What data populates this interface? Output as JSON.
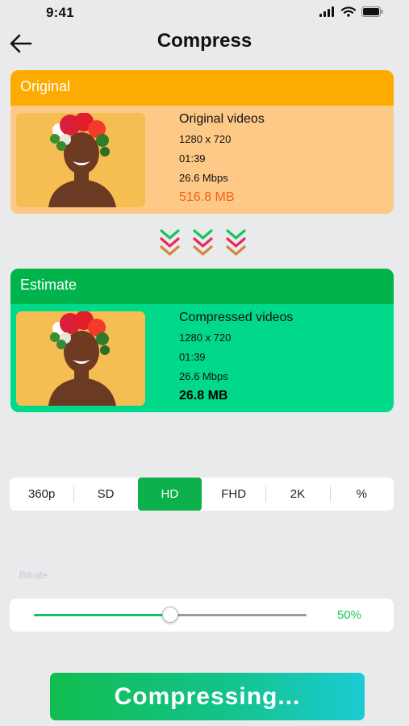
{
  "status_bar": {
    "time": "9:41"
  },
  "header": {
    "title": "Compress"
  },
  "original": {
    "section_label": "Original",
    "title": "Original videos",
    "resolution": "1280 x 720",
    "duration": "01:39",
    "bitrate": "26.6 Mbps",
    "size": "516.8 MB"
  },
  "estimate": {
    "section_label": "Estimate",
    "title": "Compressed videos",
    "resolution": "1280 x 720",
    "duration": "01:39",
    "bitrate": "26.6 Mbps",
    "size": "26.8 MB"
  },
  "resolutions": {
    "options": [
      "360p",
      "SD",
      "HD",
      "FHD",
      "2K",
      "%"
    ],
    "selected": "HD"
  },
  "bitrate": {
    "label": "Bitrate",
    "value_label": "50%",
    "value": 0.5
  },
  "action": {
    "label": "Compressing..."
  },
  "colors": {
    "original_header": "#fdab00",
    "original_body": "#fec986",
    "estimate_header": "#00b34a",
    "estimate_body": "#00d98a",
    "accent_green": "#0cb14b",
    "size_orange": "#f1611b"
  }
}
